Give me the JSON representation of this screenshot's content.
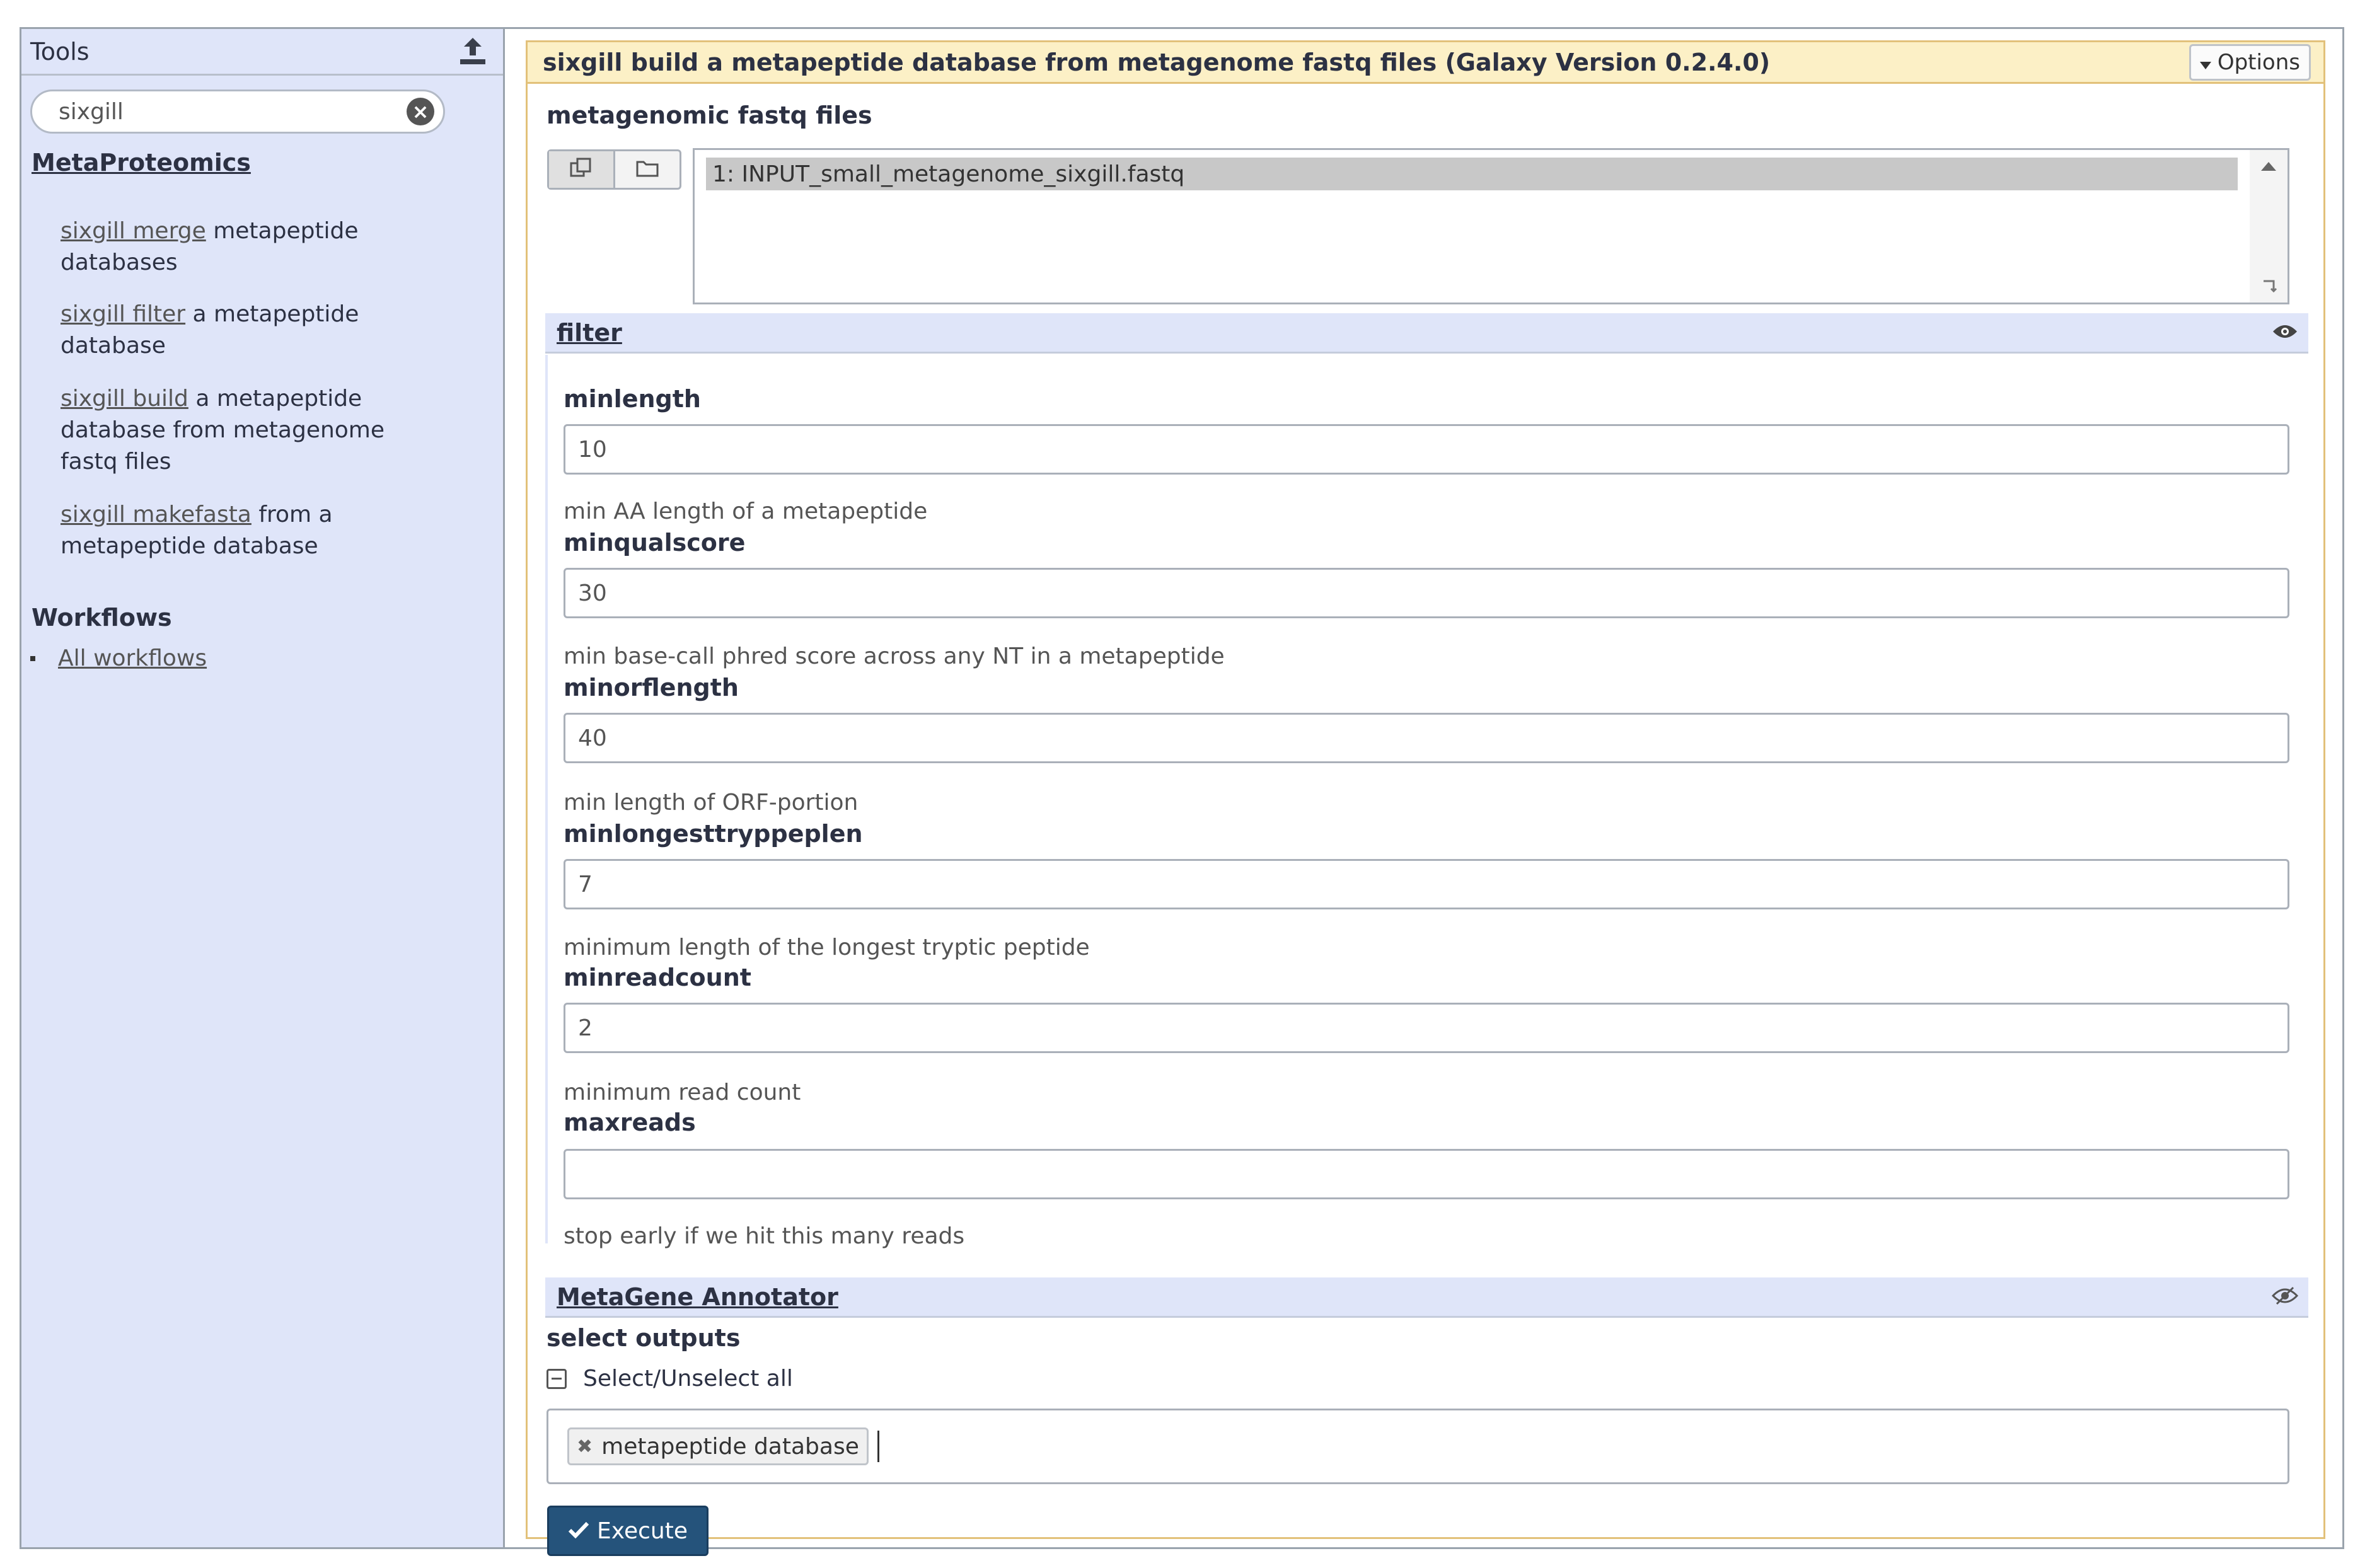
{
  "sidebar": {
    "title": "Tools",
    "upload_icon": "upload-icon",
    "search": {
      "value": "sixgill",
      "clear_icon": "clear-icon"
    },
    "section_title": "MetaProteomics",
    "tools": [
      {
        "link": "sixgill merge",
        "rest": " metapeptide databases"
      },
      {
        "link": "sixgill filter",
        "rest": " a metapeptide database"
      },
      {
        "link": "sixgill build",
        "rest": " a metapeptide database from metagenome fastq files"
      },
      {
        "link": "sixgill makefasta",
        "rest": " from a metapeptide database"
      }
    ],
    "workflows_title": "Workflows",
    "all_workflows": "All workflows"
  },
  "tool": {
    "title": "sixgill build a metapeptide database from metagenome fastq files (Galaxy Version 0.2.4.0)",
    "options_label": "Options",
    "input_label": "metagenomic fastq files",
    "dataset_selected": "1: INPUT_small_metagenome_sixgill.fastq",
    "filter_section": "filter",
    "params": [
      {
        "label": "minlength",
        "value": "10",
        "help": "min AA length of a metapeptide"
      },
      {
        "label": "minqualscore",
        "value": "30",
        "help": "min base-call phred score across any NT in a metapeptide"
      },
      {
        "label": "minorflength",
        "value": "40",
        "help": "min length of ORF-portion"
      },
      {
        "label": "minlongesttryppeplen",
        "value": "7",
        "help": "minimum length of the longest tryptic peptide"
      },
      {
        "label": "minreadcount",
        "value": "2",
        "help": "minimum read count"
      },
      {
        "label": "maxreads",
        "value": "",
        "help": "stop early if we hit this many reads"
      }
    ],
    "metagene_section": "MetaGene Annotator",
    "select_outputs_label": "select outputs",
    "select_all_label": "Select/Unselect all",
    "output_tag": "metapeptide database",
    "execute_label": "Execute"
  },
  "colors": {
    "sidebar_bg": "#dfe5f9",
    "title_bar_bg": "#fcf0c6",
    "panel_border": "#e2c17a",
    "execute_bg": "#25537b"
  }
}
